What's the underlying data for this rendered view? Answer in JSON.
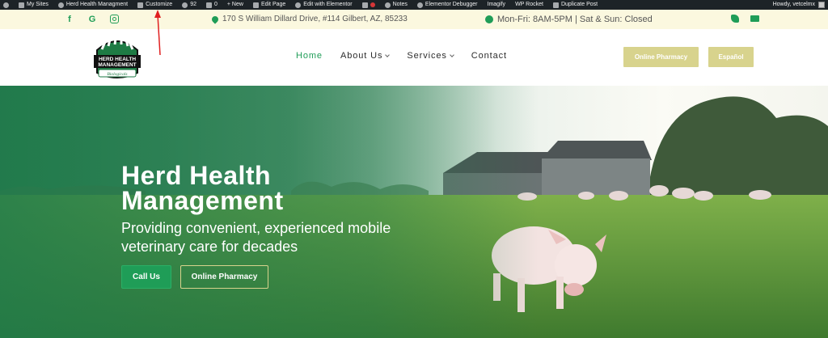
{
  "admin_bar": {
    "items": [
      "My Sites",
      "Herd Health Managment",
      "Customize",
      "92",
      "0",
      "+ New",
      "Edit Page",
      "Edit with Elementor",
      "Notes",
      "Elementor Debugger",
      "Imagify",
      "WP Rocket",
      "Duplicate Post"
    ],
    "howdy": "Howdy, vetcelmx"
  },
  "info_bar": {
    "address": "170 S William Dillard Drive, #114 Gilbert, AZ, 85233",
    "hours": "Mon-Fri: 8AM-5PM | Sat & Sun: Closed",
    "social": [
      "facebook-icon",
      "google-icon",
      "instagram-icon"
    ]
  },
  "logo": {
    "lines": [
      "HERD HEALTH",
      "MANAGEMENT",
      "Biologicals"
    ]
  },
  "nav": {
    "items": [
      {
        "label": "Home",
        "active": true
      },
      {
        "label": "About Us",
        "dropdown": true
      },
      {
        "label": "Services",
        "dropdown": true
      },
      {
        "label": "Contact"
      }
    ]
  },
  "header_buttons": {
    "pharmacy": "Online Pharmacy",
    "espanol": "Español"
  },
  "hero": {
    "title_line1": "Herd Health",
    "title_line2": "Management",
    "subtitle_line1": "Providing convenient, experienced mobile",
    "subtitle_line2": "veterinary care for decades",
    "call_button": "Call Us",
    "pharmacy_button": "Online Pharmacy"
  },
  "colors": {
    "accent_green": "#1f9d57",
    "gold": "#d8d38d",
    "admin_bar": "#1d2327",
    "info_bar_bg": "#fbf8df"
  }
}
